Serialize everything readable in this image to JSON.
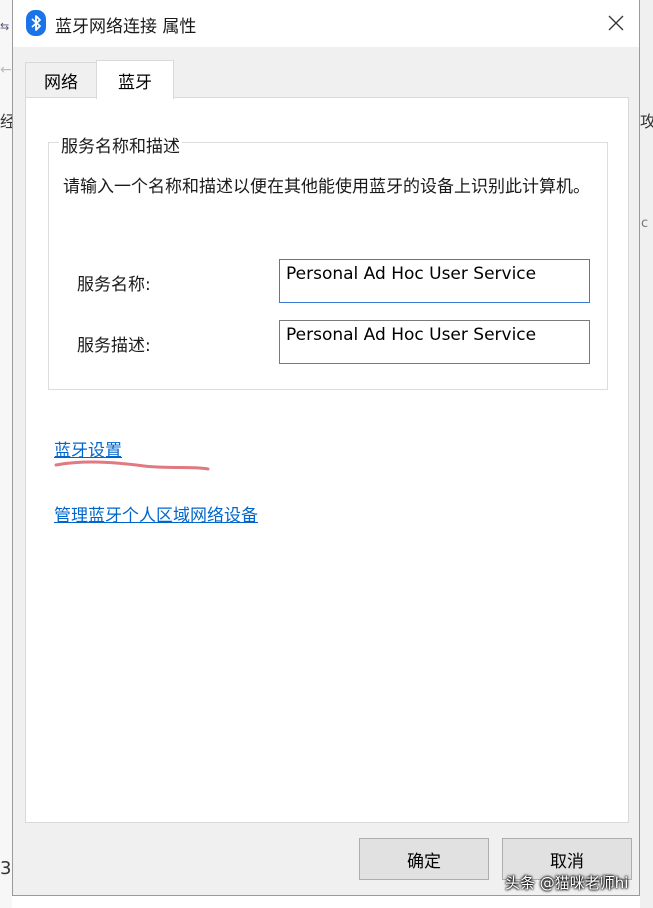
{
  "background": {
    "left_fragments": [
      "⇆",
      "←",
      "经",
      "3"
    ],
    "right_fragments": [
      "攻",
      "c"
    ]
  },
  "window": {
    "title": "蓝牙网络连接 属性",
    "icons": {
      "app": "bluetooth-icon",
      "close": "close-icon"
    }
  },
  "tabs": [
    {
      "label": "网络",
      "active": false
    },
    {
      "label": "蓝牙",
      "active": true
    }
  ],
  "service_group": {
    "legend": "服务名称和描述",
    "description": "请输入一个名称和描述以便在其他能使用蓝牙的设备上识别此计算机。",
    "name_label": "服务名称:",
    "name_value": "Personal Ad Hoc User Service",
    "desc_label": "服务描述:",
    "desc_value": "Personal Ad Hoc User Service"
  },
  "links": {
    "bluetooth_settings": "蓝牙设置",
    "manage_pan_devices": "管理蓝牙个人区域网络设备"
  },
  "buttons": {
    "ok": "确定",
    "cancel": "取消"
  },
  "watermark": "头条 @猫咪老师hi",
  "colors": {
    "accent_blue": "#1a73e8",
    "link_blue": "#0066cc",
    "annotation_red": "#e07a80"
  }
}
